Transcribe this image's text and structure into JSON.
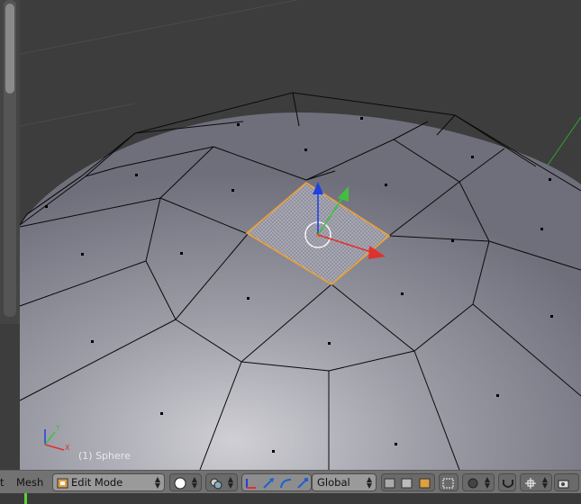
{
  "viewport": {
    "object_label": "(1) Sphere"
  },
  "header": {
    "menu_partial": "t",
    "menu_mesh": "Mesh",
    "mode_label": "Edit Mode",
    "orientation_label": "Global"
  },
  "colors": {
    "background": "#3d3d3d",
    "mesh_surface": "#9a9aa6",
    "selected_face_outline": "#f0a030",
    "header": "#727272",
    "axis_x": "#e03030",
    "axis_y": "#40c040",
    "axis_z": "#2040e0",
    "timeline_marker": "#5fd03a"
  },
  "icons": {
    "mode": "edit-mode-icon",
    "shading": "solid-sphere-icon",
    "pivot": "pivot-icon",
    "manipulator": "manipulator-icon"
  }
}
